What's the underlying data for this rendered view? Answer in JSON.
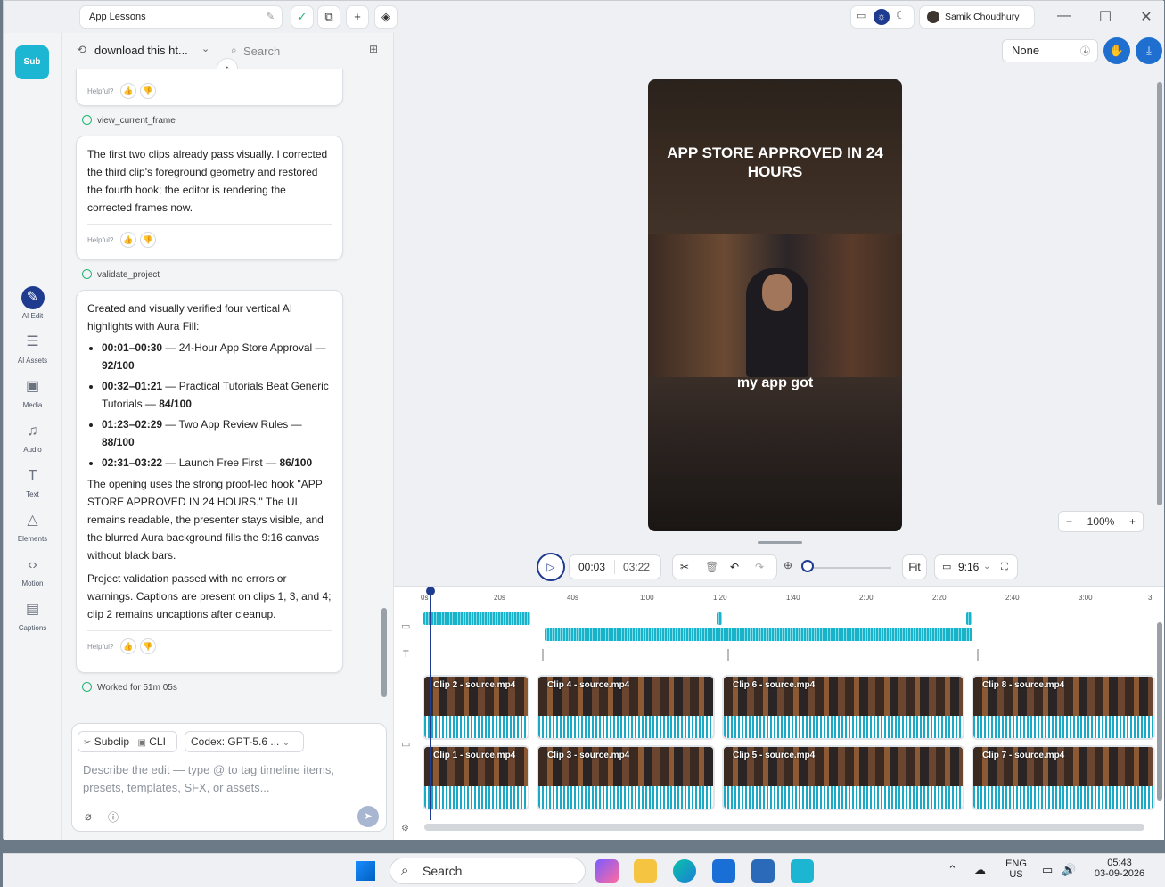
{
  "titlebar": {
    "project_name": "App Lessons",
    "user_name": "Samik Choudhury"
  },
  "rail": {
    "logo": "Sub",
    "items": [
      {
        "label": "AI Edit",
        "icon": "magic-wand-icon"
      },
      {
        "label": "AI Assets",
        "icon": "layers-icon"
      },
      {
        "label": "Media",
        "icon": "image-icon"
      },
      {
        "label": "Audio",
        "icon": "music-icon"
      },
      {
        "label": "Text",
        "icon": "text-icon"
      },
      {
        "label": "Elements",
        "icon": "shapes-icon"
      },
      {
        "label": "Motion",
        "icon": "code-icon"
      },
      {
        "label": "Captions",
        "icon": "captions-icon"
      }
    ]
  },
  "chat": {
    "thread_title": "download this ht...",
    "search_placeholder": "Search",
    "helpful_label": "Helpful?",
    "tool_1": "view_current_frame",
    "msg_1": "The first two clips already pass visually. I corrected the third clip's foreground geometry and restored the fourth hook; the editor is rendering the corrected frames now.",
    "tool_2": "validate_project",
    "msg_2_intro": "Created and visually verified four vertical AI highlights with Aura Fill:",
    "highlights": [
      {
        "time": "00:01–00:30",
        "title": " — 24-Hour App Store Approval — ",
        "score": "92/100"
      },
      {
        "time": "00:32–01:21",
        "title": " — Practical Tutorials Beat Generic Tutorials — ",
        "score": "84/100"
      },
      {
        "time": "01:23–02:29",
        "title": " — Two App Review Rules — ",
        "score": "88/100"
      },
      {
        "time": "02:31–03:22",
        "title": " — Launch Free First — ",
        "score": "86/100"
      }
    ],
    "msg_2_para1": "The opening uses the strong proof-led hook \"APP STORE APPROVED IN 24 HOURS.\" The UI remains readable, the presenter stays visible, and the blurred Aura background fills the 9:16 canvas without black bars.",
    "msg_2_para2": "Project validation passed with no errors or warnings. Captions are present on clips 1, 3, and 4; clip 2 remains uncaptions after cleanup.",
    "worked_for": "Worked for 51m 05s",
    "composer": {
      "chip_subclip": "Subclip",
      "chip_cli": "CLI",
      "model": "Codex: GPT-5.6 ...",
      "placeholder": "Describe the edit — type @ to tag timeline items, presets, templates, SFX, or assets..."
    }
  },
  "editor": {
    "preset": "None",
    "preview_title": "APP STORE APPROVED IN 24 HOURS",
    "preview_caption": "my app got",
    "zoom": "100%",
    "current_time": "00:03",
    "duration": "03:22",
    "fit_label": "Fit",
    "aspect": "9:16",
    "ruler_ticks": [
      "0s",
      "20s",
      "40s",
      "1:00",
      "1:20",
      "1:40",
      "2:00",
      "2:20",
      "2:40",
      "3:00",
      "3"
    ],
    "clips_top": [
      "Clip 2 - source.mp4",
      "Clip 4 - source.mp4",
      "Clip 6 - source.mp4",
      "Clip 8 - source.mp4"
    ],
    "clips_bottom": [
      "Clip 1 - source.mp4",
      "Clip 3 - source.mp4",
      "Clip 5 - source.mp4",
      "Clip 7 - source.mp4"
    ]
  },
  "taskbar": {
    "search": "Search",
    "lang_top": "ENG",
    "lang_bottom": "US",
    "time": "05:43",
    "date": "03-09-2026"
  }
}
